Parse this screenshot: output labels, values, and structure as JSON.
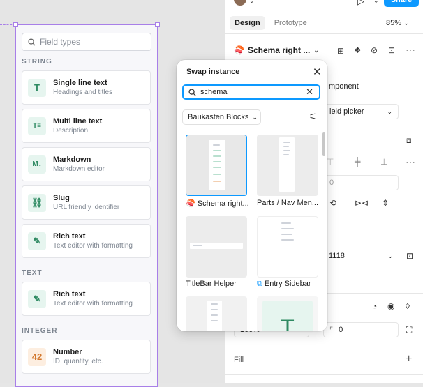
{
  "fields_panel": {
    "search_placeholder": "Field types",
    "sections": {
      "string": "STRING",
      "text": "TEXT",
      "integer": "INTEGER"
    },
    "items": [
      {
        "title": "Single line text",
        "subtitle": "Headings and titles",
        "icon": "T"
      },
      {
        "title": "Multi line text",
        "subtitle": "Description",
        "icon": "T≡"
      },
      {
        "title": "Markdown",
        "subtitle": "Markdown editor",
        "icon": "M↓"
      },
      {
        "title": "Slug",
        "subtitle": "URL friendly identifier",
        "icon": "⛓"
      },
      {
        "title": "Rich text",
        "subtitle": "Text editor with formatting",
        "icon": "✎"
      },
      {
        "title": "Rich text",
        "subtitle": "Text editor with formatting",
        "icon": "✎"
      },
      {
        "title": "Number",
        "subtitle": "ID, quantity, etc.",
        "icon": "42"
      }
    ]
  },
  "properties": {
    "share_label": "Share",
    "tabs": [
      "Design",
      "Prototype"
    ],
    "zoom": "85%",
    "component_name": "Schema right ...",
    "component_emoji": "🍣",
    "component_field": "mponent",
    "variant_field": "ield picker",
    "position_value": "0",
    "height_value": "1118",
    "rotation_value": "100%",
    "stroke_value": "0",
    "fill_label": "Fill"
  },
  "swap_instance": {
    "title": "Swap instance",
    "search_value": "schema",
    "library": "Baukasten Blocks",
    "results": [
      {
        "label": "🍣 Schema right..."
      },
      {
        "label": "Parts / Nav Men..."
      },
      {
        "label": "TitleBar Helper"
      },
      {
        "label": "Entry Sidebar"
      }
    ],
    "partial_thumb_letter": "T"
  },
  "colors": {
    "accent": "#0d99ff",
    "selection": "#a87fe8",
    "field_icon_green": "#2e8a62",
    "field_icon_orange": "#d2772d"
  }
}
